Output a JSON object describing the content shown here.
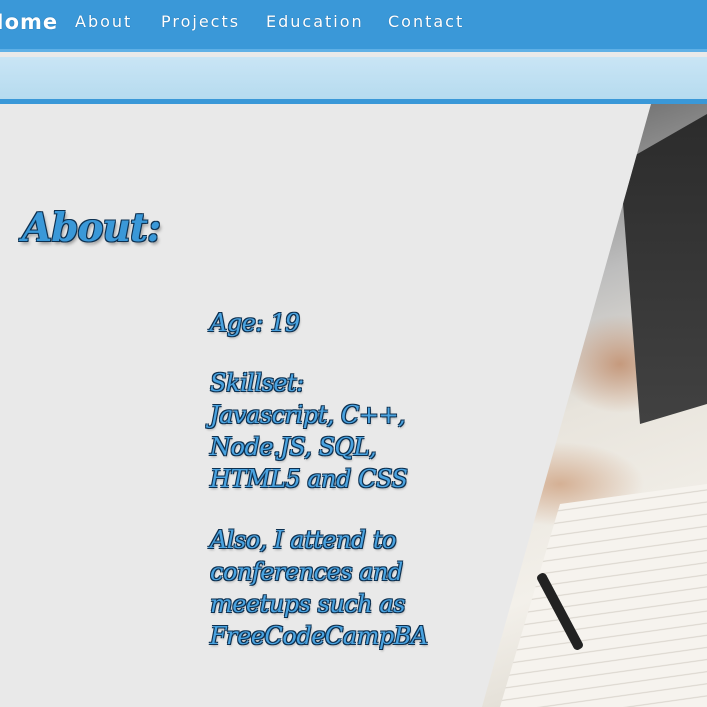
{
  "nav": {
    "home_label": "Home",
    "about_label": "About",
    "projects_label": "Projects",
    "education_label": "Education",
    "contact_label": "Contact"
  },
  "colors": {
    "nav_background": "#3a98d8",
    "subbar_background": "#c9e5f5",
    "page_background": "#e9e9e9",
    "text_accent": "#4aa3e0"
  },
  "about": {
    "heading": "About:",
    "age": "Age: 19",
    "skillset_lines": [
      "Skillset:",
      "Javascript, C++,",
      "Node.JS, SQL,",
      "HTML5 and CSS"
    ],
    "extra_lines": [
      "Also, I attend to",
      "conferences and",
      "meetups such as",
      "FreeCodeCampBA"
    ]
  },
  "photo": {
    "description_icon": "laptop-desk-photo"
  }
}
